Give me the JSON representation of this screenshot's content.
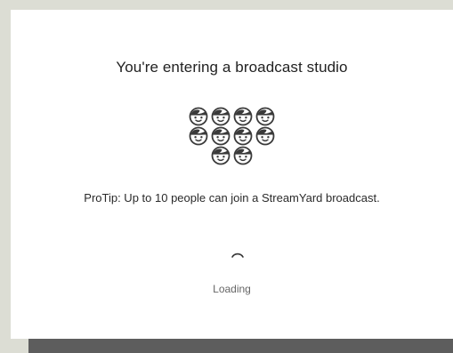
{
  "dialog": {
    "title": "You're entering a broadcast studio",
    "protip": "ProTip: Up to 10 people can join a StreamYard broadcast.",
    "loading_label": "Loading"
  },
  "faces": {
    "icon": "face-icon",
    "rows": [
      4,
      4,
      2
    ]
  },
  "colors": {
    "background": "#dcddd4",
    "dialog": "#ffffff",
    "bottom_bar": "#5d5d5d",
    "icon_stroke": "#3a3a3a"
  }
}
